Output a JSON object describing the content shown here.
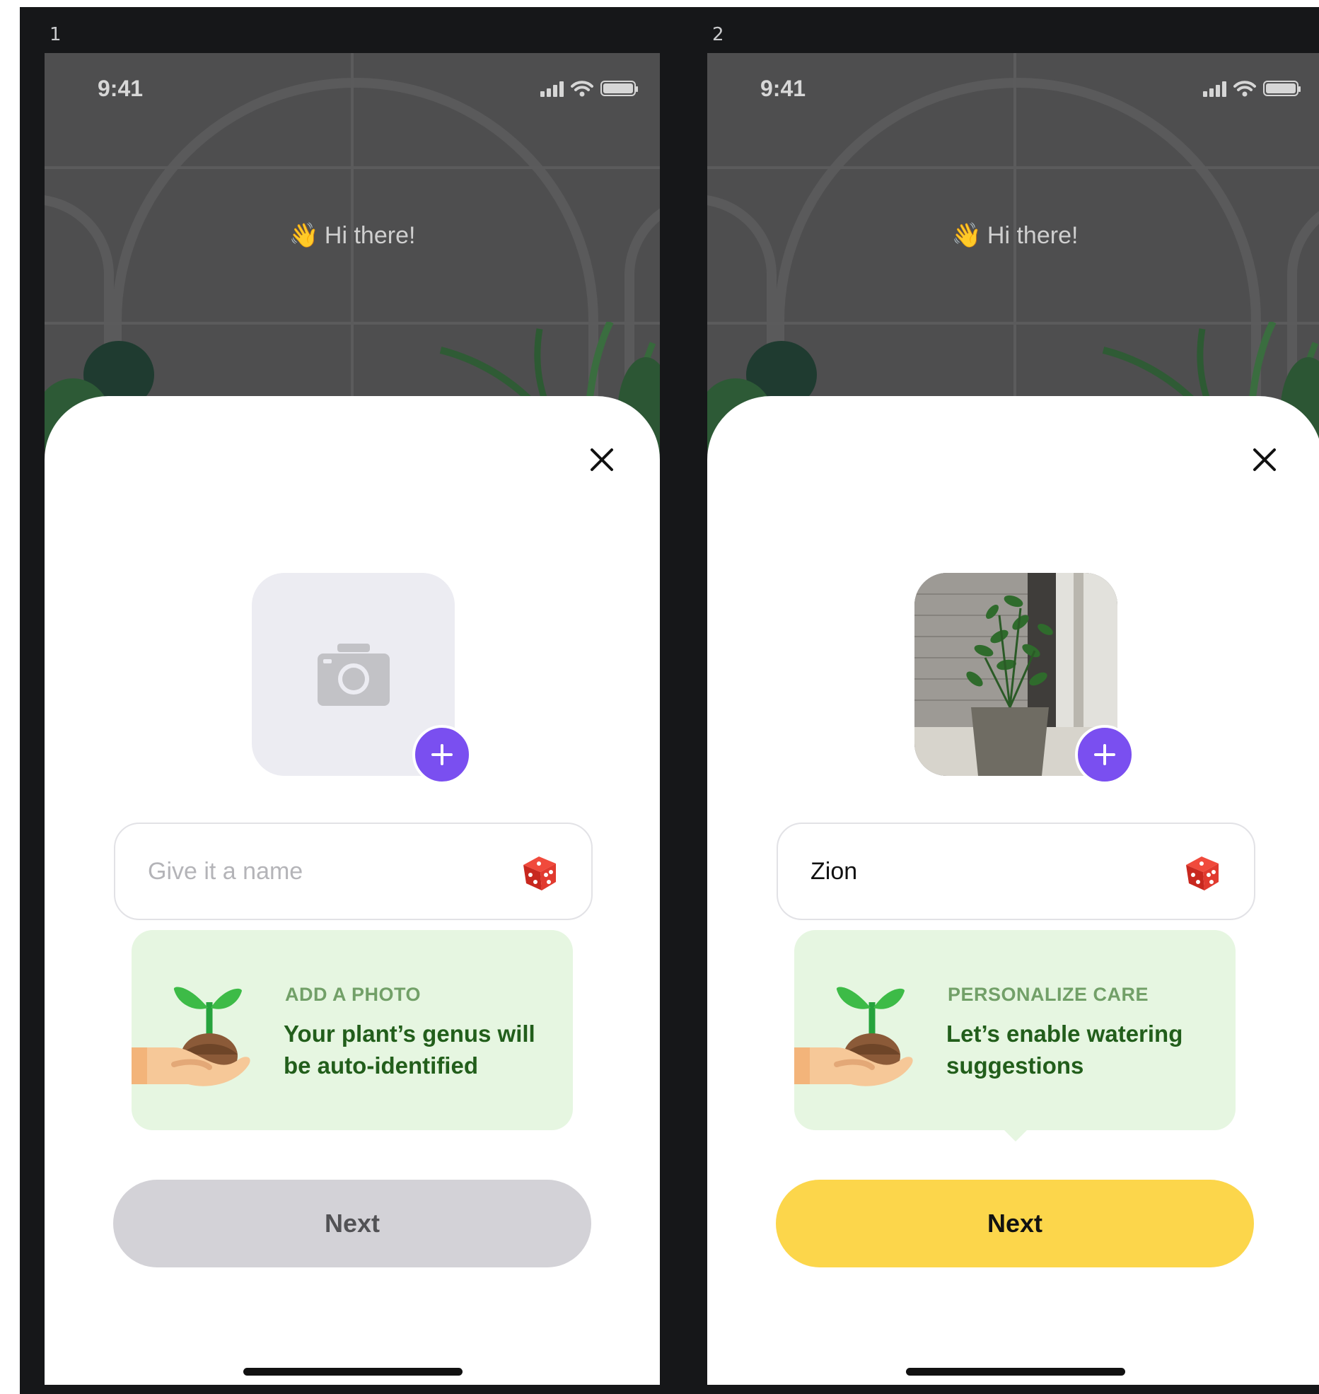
{
  "screens": [
    {
      "index": "1",
      "status_time": "9:41",
      "greeting_emoji": "👋",
      "greeting": "Hi there!",
      "photo_state": "empty",
      "name_value": "",
      "name_placeholder": "Give it a name",
      "tip_kicker": "ADD A PHOTO",
      "tip_text": "Your plant’s genus will be auto-identified",
      "next_label": "Next",
      "next_state": "disabled"
    },
    {
      "index": "2",
      "status_time": "9:41",
      "greeting_emoji": "👋",
      "greeting": "Hi there!",
      "photo_state": "filled",
      "name_value": "Zion",
      "name_placeholder": "Give it a name",
      "tip_kicker": "PERSONALIZE CARE",
      "tip_text": "Let’s enable watering suggestions",
      "next_label": "Next",
      "next_state": "enabled"
    }
  ],
  "icons": {
    "close": "close-icon",
    "camera": "camera-icon",
    "add": "plus-icon",
    "dice": "dice-icon",
    "plant_hand": "plant-in-hand-illustration",
    "signal": "signal-icon",
    "wifi": "wifi-icon",
    "battery": "battery-icon"
  },
  "colors": {
    "accent_purple": "#7a4ff0",
    "next_disabled": "#d3d2d7",
    "next_enabled": "#fcd64b",
    "tip_bg": "#e6f6e1",
    "tip_kicker": "#72a068",
    "tip_text": "#225e1b"
  }
}
